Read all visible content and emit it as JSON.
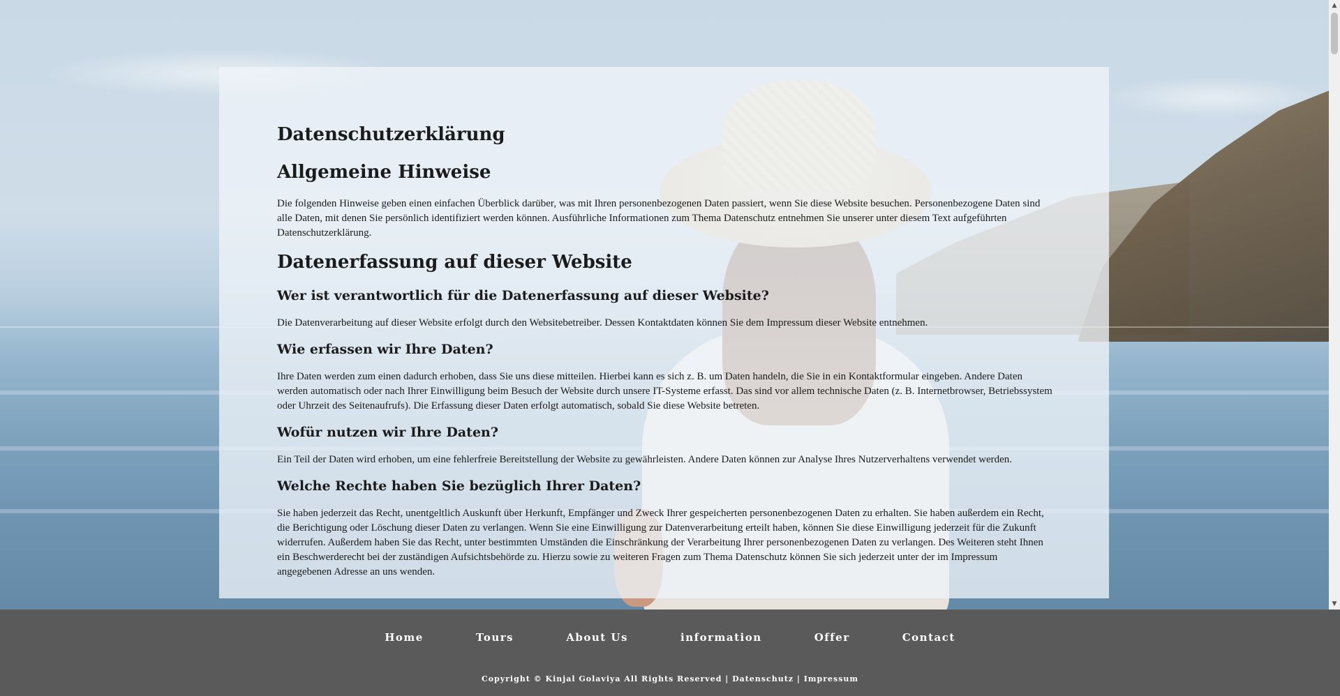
{
  "content": {
    "title": "Datenschutzerklärung",
    "section1_heading": "Allgemeine Hinweise",
    "section1_text": "Die folgenden Hinweise geben einen einfachen Überblick darüber, was mit Ihren personenbezogenen Daten passiert, wenn Sie diese Website besuchen. Personenbezogene Daten sind alle Daten, mit denen Sie persönlich identifiziert werden können. Ausführliche Informationen zum Thema Datenschutz entnehmen Sie unserer unter diesem Text aufgeführten Datenschutzerklärung.",
    "section2_heading": "Datenerfassung auf dieser Website",
    "q1_heading": "Wer ist verantwortlich für die Datenerfassung auf dieser Website?",
    "q1_text": "Die Datenverarbeitung auf dieser Website erfolgt durch den Websitebetreiber. Dessen Kontaktdaten können Sie dem Impressum dieser Website entnehmen.",
    "q2_heading": "Wie erfassen wir Ihre Daten?",
    "q2_text": "Ihre Daten werden zum einen dadurch erhoben, dass Sie uns diese mitteilen. Hierbei kann es sich z. B. um Daten handeln, die Sie in ein Kontaktformular eingeben. Andere Daten werden automatisch oder nach Ihrer Einwilligung beim Besuch der Website durch unsere IT-Systeme erfasst. Das sind vor allem technische Daten (z. B. Internetbrowser, Betriebssystem oder Uhrzeit des Seitenaufrufs). Die Erfassung dieser Daten erfolgt automatisch, sobald Sie diese Website betreten.",
    "q3_heading": "Wofür nutzen wir Ihre Daten?",
    "q3_text": "Ein Teil der Daten wird erhoben, um eine fehlerfreie Bereitstellung der Website zu gewährleisten. Andere Daten können zur Analyse Ihres Nutzerverhaltens verwendet werden.",
    "q4_heading": "Welche Rechte haben Sie bezüglich Ihrer Daten?",
    "q4_text": "Sie haben jederzeit das Recht, unentgeltlich Auskunft über Herkunft, Empfänger und Zweck Ihrer gespeicherten personenbezogenen Daten zu erhalten. Sie haben außerdem ein Recht, die Berichtigung oder Löschung dieser Daten zu verlangen. Wenn Sie eine Einwilligung zur Datenverarbeitung erteilt haben, können Sie diese Einwilligung jederzeit für die Zukunft widerrufen. Außerdem haben Sie das Recht, unter bestimmten Umständen die Einschränkung der Verarbeitung Ihrer personenbezogenen Daten zu verlangen. Des Weiteren steht Ihnen ein Beschwerderecht bei der zuständigen Aufsichtsbehörde zu. Hierzu sowie zu weiteren Fragen zum Thema Datenschutz können Sie sich jederzeit unter der im Impressum angegebenen Adresse an uns wenden."
  },
  "footer": {
    "nav": {
      "home": "Home",
      "tours": "Tours",
      "about": "About Us",
      "information": "information",
      "offer": "Offer",
      "contact": "Contact"
    },
    "copyright_text": "Copyright © Kinjal Golaviya All Rights Reserved |",
    "datenschutz_link": "Datenschutz",
    "separator": "|",
    "impressum_link": "Impressum"
  },
  "scrollbar": {
    "up_arrow": "▲",
    "down_arrow": "▼"
  }
}
